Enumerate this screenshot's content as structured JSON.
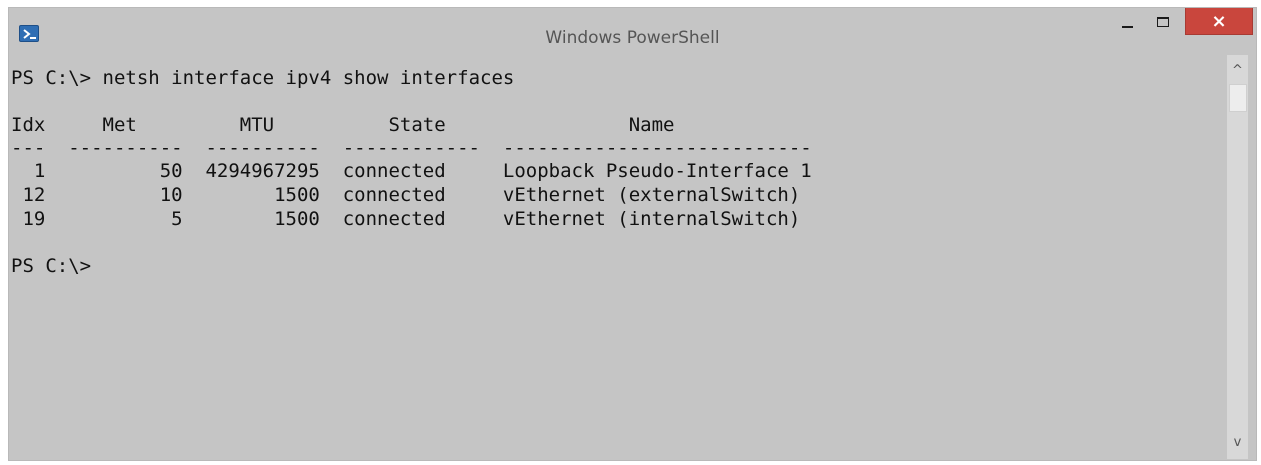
{
  "window": {
    "title": "Windows PowerShell",
    "close_glyph": "×"
  },
  "console": {
    "prompt": "PS C:\\> ",
    "command": "netsh interface ipv4 show interfaces",
    "header_line": "Idx     Met         MTU          State                Name",
    "separator_line": "---  ----------  ----------  ------------  ---------------------------",
    "rows": [
      "  1          50  4294967295  connected     Loopback Pseudo-Interface 1",
      " 12          10        1500  connected     vEthernet (externalSwitch)",
      " 19           5        1500  connected     vEthernet (internalSwitch)"
    ],
    "final_prompt": "PS C:\\>"
  },
  "scrollbar": {
    "up_glyph": "^",
    "down_glyph": "v"
  },
  "colors": {
    "background": "#c5c5c5",
    "text": "#111111",
    "close": "#c9463d"
  }
}
